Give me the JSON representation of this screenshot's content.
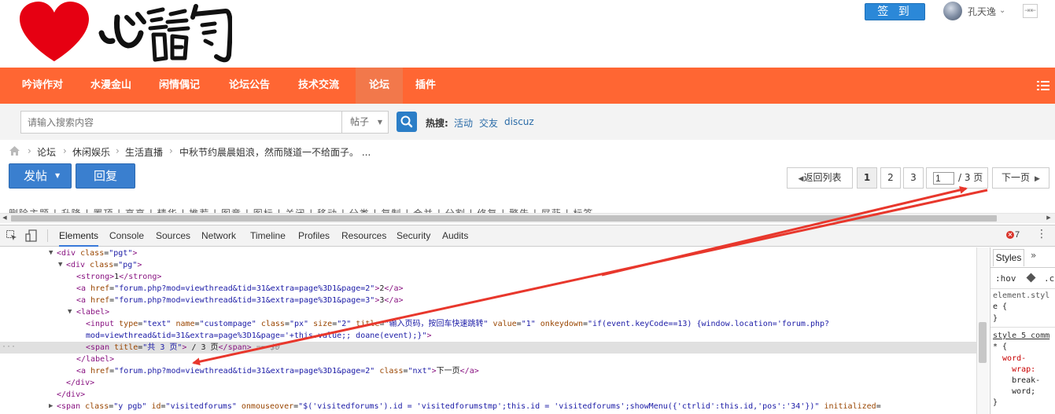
{
  "header": {
    "logo_text": "心韵",
    "checkin_label": "签 到",
    "username": "孔天逸",
    "toggle_icon": "collapse-icon"
  },
  "nav": {
    "items": [
      {
        "label": "吟诗作对",
        "active": false
      },
      {
        "label": "水漫金山",
        "active": false
      },
      {
        "label": "闲情偶记",
        "active": false
      },
      {
        "label": "论坛公告",
        "active": false
      },
      {
        "label": "技术交流",
        "active": false
      },
      {
        "label": "论坛",
        "active": true
      },
      {
        "label": "插件",
        "active": false
      }
    ],
    "menu_icon": "hamburger-icon"
  },
  "search": {
    "placeholder": "请输入搜索内容",
    "type_label": "帖子",
    "hot_label": "热搜:",
    "hot_links": [
      "活动",
      "交友",
      "discuz"
    ]
  },
  "breadcrumb": {
    "items": [
      "论坛",
      "休闲娱乐",
      "生活直播",
      "中秋节约晨晨姐浪，然而隧道一不给面子。 ..."
    ]
  },
  "actions": {
    "post_label": "发帖",
    "reply_label": "回复"
  },
  "pagination": {
    "back_label": "返回列表",
    "pages": [
      "1",
      "2",
      "3"
    ],
    "current_value": "1",
    "total_label": "/ 3 页",
    "next_label": "下一页"
  },
  "mod_row_text": "删除主题 | 升降 | 置顶 | 高亮 | 精华 | 推荐 | 图章 | 图标 | 关闭 | 移动 | 分类 | 复制 | 合并 | 分割 | 修复 | 警告 | 屏蔽 | 标签",
  "devtools": {
    "tabs": [
      "Elements",
      "Console",
      "Sources",
      "Network",
      "Timeline",
      "Profiles",
      "Resources",
      "Security",
      "Audits"
    ],
    "active_tab": "Elements",
    "error_count": "7",
    "selected_suffix": "== $0",
    "styles": {
      "tab_label": "Styles",
      "hov_label": ":hov",
      "cls_label": ".c",
      "lines": [
        "element.styl",
        "e {",
        "}",
        "style 5 comm",
        "* {",
        "  word-",
        "    wrap:",
        "    break-",
        "    word;",
        "}"
      ]
    }
  }
}
